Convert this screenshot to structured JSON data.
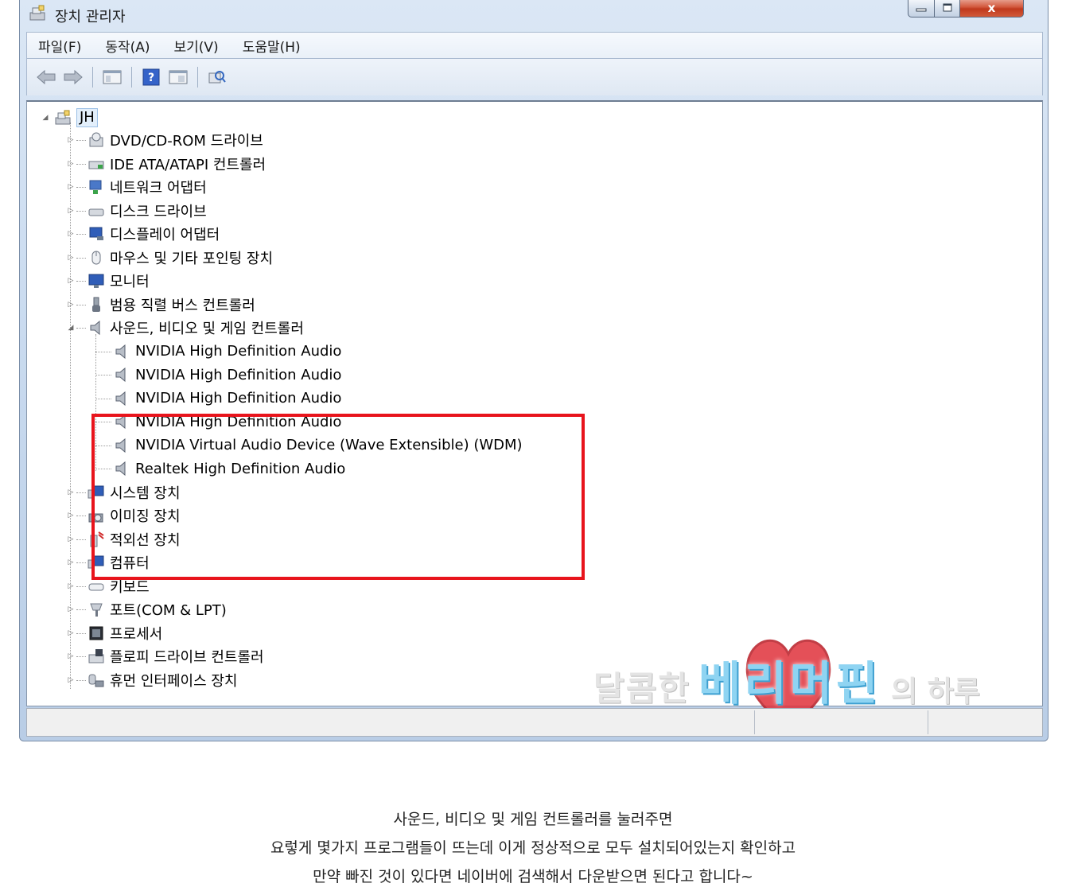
{
  "window": {
    "title": "장치 관리자",
    "close_glyph": "x"
  },
  "menu": [
    "파일(F)",
    "동작(A)",
    "보기(V)",
    "도움말(H)"
  ],
  "toolbar_icons": [
    "back-icon",
    "forward-icon",
    "show-hide-console-tree-icon",
    "help-icon",
    "properties-icon",
    "scan-hardware-icon"
  ],
  "tree": {
    "root": "JH",
    "categories_before": [
      {
        "label": "DVD/CD-ROM 드라이브",
        "icon": "dvd-drive-icon"
      },
      {
        "label": "IDE ATA/ATAPI 컨트롤러",
        "icon": "ide-controller-icon"
      },
      {
        "label": "네트워크 어댑터",
        "icon": "network-adapter-icon"
      },
      {
        "label": "디스크 드라이브",
        "icon": "disk-drive-icon"
      },
      {
        "label": "디스플레이 어댑터",
        "icon": "display-adapter-icon"
      },
      {
        "label": "마우스 및 기타 포인팅 장치",
        "icon": "mouse-icon"
      },
      {
        "label": "모니터",
        "icon": "monitor-icon"
      },
      {
        "label": "범용 직렬 버스 컨트롤러",
        "icon": "usb-icon"
      }
    ],
    "expanded": {
      "label": "사운드, 비디오 및 게임 컨트롤러",
      "icon": "speaker-icon",
      "children": [
        "NVIDIA High Definition Audio",
        "NVIDIA High Definition Audio",
        "NVIDIA High Definition Audio",
        "NVIDIA High Definition Audio",
        "NVIDIA Virtual Audio Device (Wave Extensible) (WDM)",
        "Realtek High Definition Audio"
      ]
    },
    "categories_after": [
      {
        "label": "시스템 장치",
        "icon": "system-device-icon"
      },
      {
        "label": "이미징 장치",
        "icon": "imaging-device-icon"
      },
      {
        "label": "적외선 장치",
        "icon": "infrared-device-icon"
      },
      {
        "label": "컴퓨터",
        "icon": "computer-icon"
      },
      {
        "label": "키보드",
        "icon": "keyboard-icon"
      },
      {
        "label": "포트(COM & LPT)",
        "icon": "port-icon"
      },
      {
        "label": "프로세서",
        "icon": "processor-icon"
      },
      {
        "label": "플로피 드라이브 컨트롤러",
        "icon": "floppy-controller-icon"
      },
      {
        "label": "휴먼 인터페이스 장치",
        "icon": "hid-icon"
      }
    ]
  },
  "watermark": {
    "left": "달콤한",
    "main": "베리머핀",
    "right": "의 하루"
  },
  "caption_lines": [
    "사운드, 비디오 및 게임 컨트롤러를 눌러주면",
    "요렇게 몇가지 프로그램들이 뜨는데 이게 정상적으로 모두 설치되어있는지 확인하고",
    "만약 빠진 것이 있다면 네이버에 검색해서 다운받으면 된다고 합니다~"
  ],
  "colors": {
    "highlight_border": "#e8141c",
    "watermark_blue": "#8fd4f2",
    "watermark_heart": "#e0323c"
  }
}
